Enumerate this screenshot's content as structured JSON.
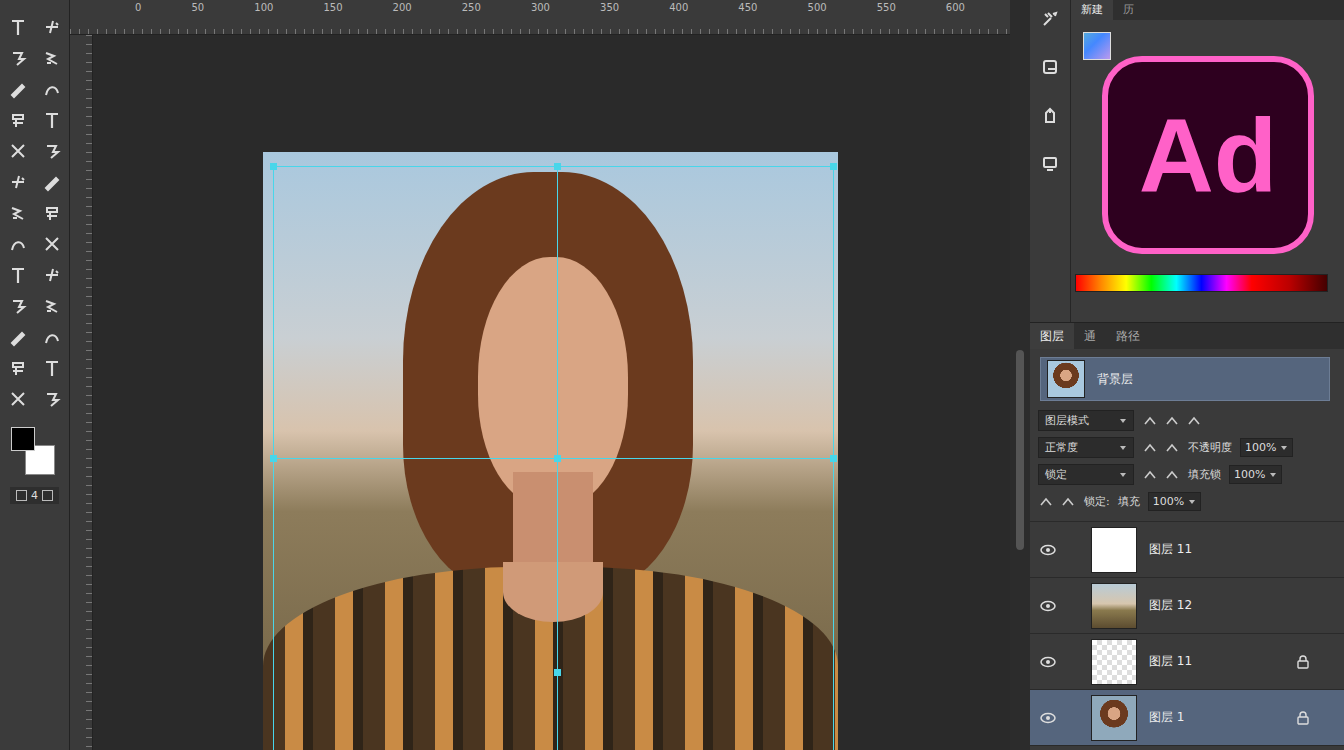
{
  "ruler": {
    "labels": [
      "0",
      "50",
      "100",
      "150",
      "200",
      "250",
      "300",
      "350",
      "400",
      "450",
      "500",
      "550",
      "600"
    ]
  },
  "tools_footer": {
    "mode": "4"
  },
  "panel_tabs": [
    {
      "label": "新建",
      "selected": true
    },
    {
      "label": "历",
      "selected": false
    }
  ],
  "logo": {
    "text": "Ad"
  },
  "layers_panel": {
    "tabs": [
      {
        "label": "图层",
        "selected": true
      },
      {
        "label": "通",
        "selected": false
      },
      {
        "label": "路径",
        "selected": false
      }
    ],
    "document": {
      "label": "背景层"
    },
    "rows": [
      {
        "dropdown": "图层模式",
        "label": "",
        "field": ""
      },
      {
        "dropdown": "正常度",
        "label": "不透明度",
        "field": "100%"
      },
      {
        "dropdown": "锁定",
        "label": "填充锁",
        "field": "100%"
      },
      {
        "dropdown": "",
        "label": "锁定:",
        "field": "100%"
      }
    ],
    "fill_label": "填充",
    "layers": [
      {
        "name": "图层 11",
        "visible": true,
        "locked": false,
        "selected": false,
        "kind": "white"
      },
      {
        "name": "图层 12",
        "visible": true,
        "locked": false,
        "selected": false,
        "kind": "landscape"
      },
      {
        "name": "图层 11",
        "visible": true,
        "locked": true,
        "selected": false,
        "kind": "transparent"
      },
      {
        "name": "图层 1",
        "visible": true,
        "locked": true,
        "selected": true,
        "kind": "portrait"
      }
    ]
  }
}
